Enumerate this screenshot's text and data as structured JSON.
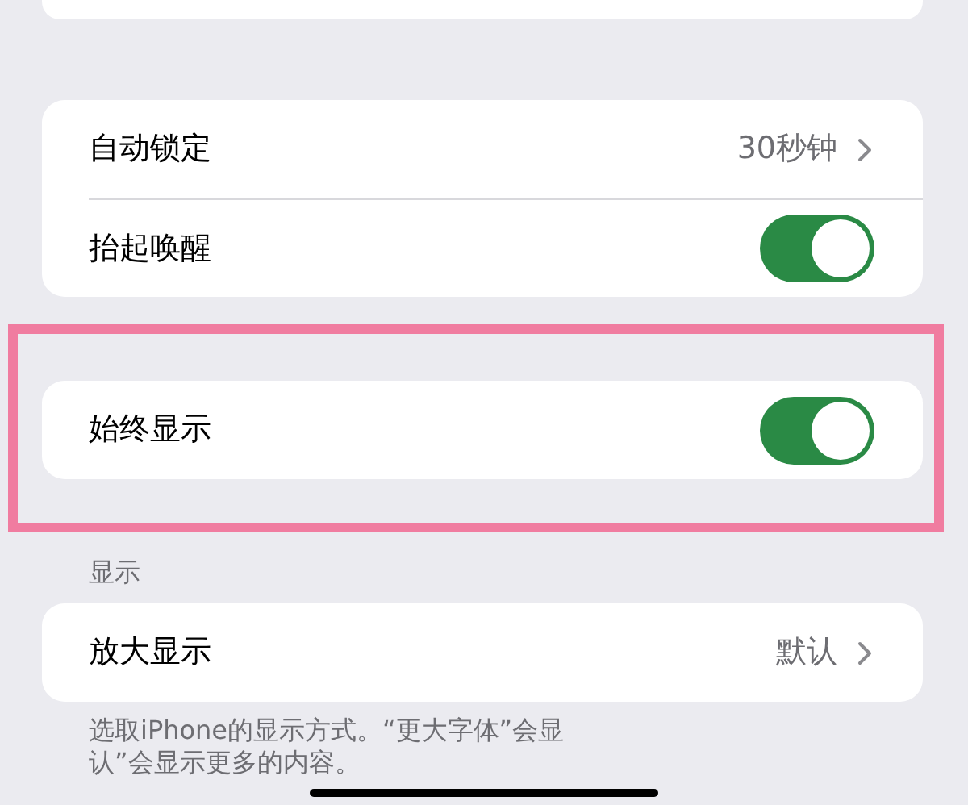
{
  "groups": [
    {
      "rows": [
        {
          "kind": "value",
          "label": "自动锁定",
          "value": "30秒钟"
        },
        {
          "kind": "toggle",
          "label": "抬起唤醒",
          "on": true
        }
      ]
    },
    {
      "highlighted": true,
      "rows": [
        {
          "kind": "toggle",
          "label": "始终显示",
          "on": true
        }
      ]
    },
    {
      "header": "显示",
      "rows": [
        {
          "kind": "value",
          "label": "放大显示",
          "value": "默认"
        }
      ],
      "footer_lines": [
        "选取iPhone的显示方式。“更大字体”会显",
        "认”会显示更多的内容。"
      ]
    }
  ]
}
